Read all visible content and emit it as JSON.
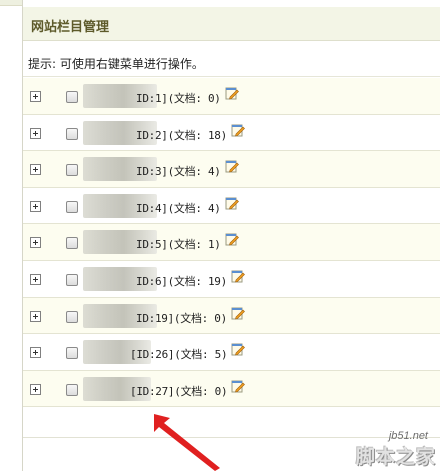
{
  "panel": {
    "title": "网站栏目管理"
  },
  "tip": "提示: 可使用右键菜单进行操作。",
  "rows": [
    {
      "label": "ID:1](文档: 0)",
      "blur_w": 50,
      "label_left": 136
    },
    {
      "label": "ID:2](文档: 18)",
      "blur_w": 50,
      "label_left": 136
    },
    {
      "label": "ID:3](文档: 4)",
      "blur_w": 50,
      "label_left": 136
    },
    {
      "label": "ID:4](文档: 4)",
      "blur_w": 50,
      "label_left": 136
    },
    {
      "label": "ID:5](文档: 1)",
      "blur_w": 50,
      "label_left": 136
    },
    {
      "label": "ID:6](文档: 19)",
      "blur_w": 50,
      "label_left": 136
    },
    {
      "label": "ID:19](文档: 0)",
      "blur_w": 50,
      "label_left": 136
    },
    {
      "label": "[ID:26](文档: 5)",
      "blur_w": 48,
      "label_left": 130
    },
    {
      "label": "[ID:27](文档: 0)",
      "blur_w": 48,
      "label_left": 130
    }
  ],
  "watermark": {
    "site": "jb51.net",
    "name": "脚本之家"
  },
  "colors": {
    "title_text": "#5d5a2a",
    "row_bg": "#fdfdf0",
    "arrow": "#e02020"
  }
}
